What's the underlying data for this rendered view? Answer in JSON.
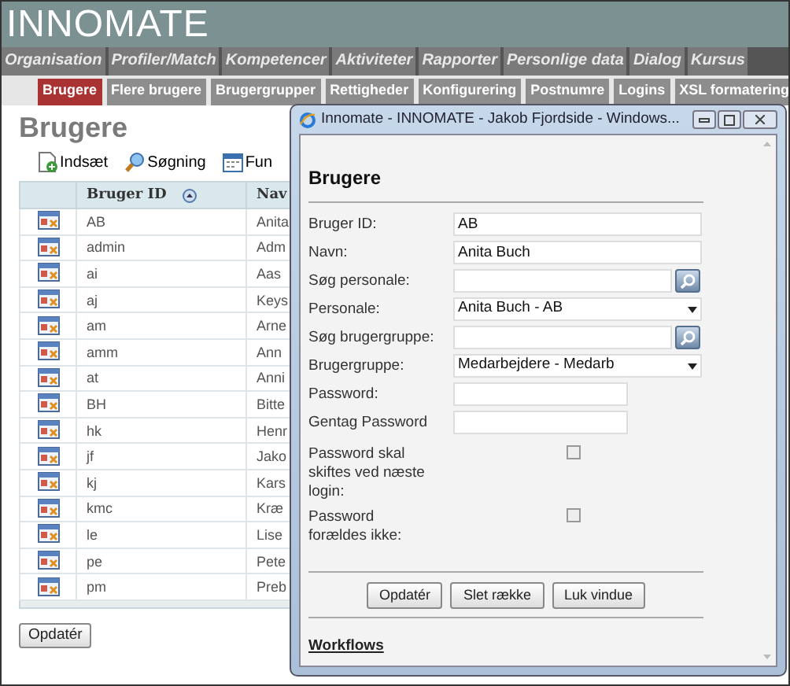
{
  "logo": "INNOMATE",
  "menu": [
    {
      "label": "Organisation",
      "selected": false
    },
    {
      "label": "Profiler/Match",
      "selected": false
    },
    {
      "label": "Kompetencer",
      "selected": false
    },
    {
      "label": "Aktiviteter",
      "selected": false
    },
    {
      "label": "Rapporter",
      "selected": false
    },
    {
      "label": "Personlige data",
      "selected": false
    },
    {
      "label": "Dialog",
      "selected": false
    },
    {
      "label": "Kursus",
      "selected": false
    }
  ],
  "submenu": [
    {
      "label": "Brugere",
      "selected": true
    },
    {
      "label": "Flere brugere",
      "selected": false
    },
    {
      "label": "Brugergrupper",
      "selected": false
    },
    {
      "label": "Rettigheder",
      "selected": false
    },
    {
      "label": "Konfigurering",
      "selected": false
    },
    {
      "label": "Postnumre",
      "selected": false
    },
    {
      "label": "Logins",
      "selected": false
    },
    {
      "label": "XSL formatering",
      "selected": false
    }
  ],
  "page_title": "Brugere",
  "toolbar": [
    {
      "kind": "insert",
      "label": "Indsæt"
    },
    {
      "kind": "search",
      "label": "Søgning"
    },
    {
      "kind": "functions",
      "label": "Fun"
    }
  ],
  "table": {
    "columns": [
      "Bruger ID",
      "Nav"
    ],
    "rows": [
      [
        "AB",
        "Anita"
      ],
      [
        "admin",
        "Adm"
      ],
      [
        "ai",
        "Aas"
      ],
      [
        "aj",
        "Keys"
      ],
      [
        "am",
        "Arne"
      ],
      [
        "amm",
        "Ann"
      ],
      [
        "at",
        "Anni"
      ],
      [
        "BH",
        "Bitte"
      ],
      [
        "hk",
        "Henr"
      ],
      [
        "jf",
        "Jako"
      ],
      [
        "kj",
        "Kars"
      ],
      [
        "kmc",
        "Kræ"
      ],
      [
        "le",
        "Lise"
      ],
      [
        "pe",
        "Pete"
      ],
      [
        "pm",
        "Preb"
      ]
    ]
  },
  "update_button": "Opdatér",
  "dialog": {
    "title": "Innomate - INNOMATE - Jakob Fjordside - Windows...",
    "heading": "Brugere",
    "fields": [
      {
        "kind": "text",
        "label": "Bruger ID:",
        "value": "AB"
      },
      {
        "kind": "text",
        "label": "Navn:",
        "value": "Anita Buch"
      },
      {
        "kind": "search",
        "label": "Søg personale:"
      },
      {
        "kind": "select",
        "label": "Personale:",
        "value": "Anita Buch - AB"
      },
      {
        "kind": "search",
        "label": "Søg brugergruppe:"
      },
      {
        "kind": "select",
        "label": "Brugergruppe:",
        "value": "Medarbejdere - Medarb"
      },
      {
        "kind": "password",
        "label": "Password:"
      },
      {
        "kind": "password",
        "label": "Gentag Password"
      },
      {
        "kind": "checkbox",
        "label": "Password skal skiftes ved næste login:",
        "checked": false
      },
      {
        "kind": "checkbox",
        "label": "Password forældes ikke:",
        "checked": false
      }
    ],
    "buttons": [
      "Opdatér",
      "Slet række",
      "Luk vindue"
    ],
    "link": "Workflows"
  }
}
